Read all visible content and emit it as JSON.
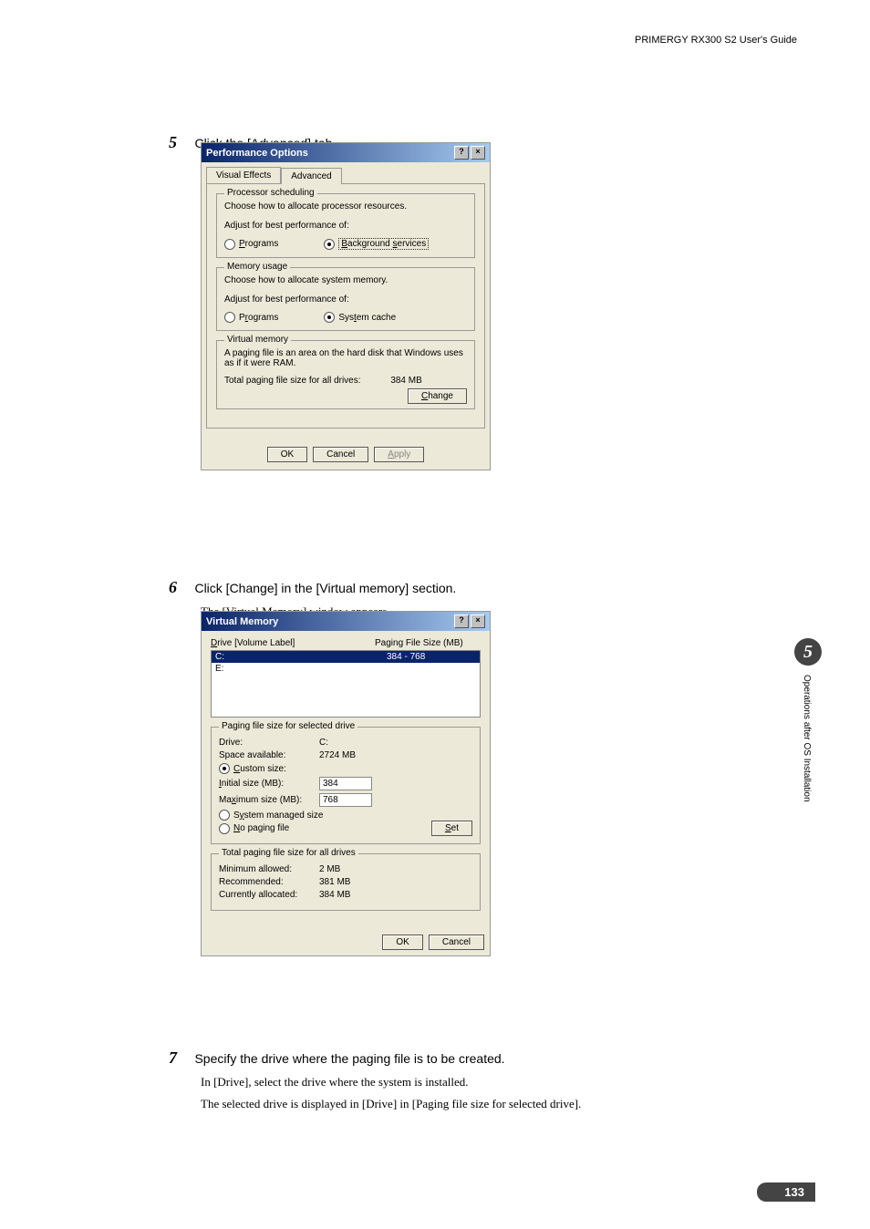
{
  "header": "PRIMERGY RX300 S2 User's Guide",
  "steps": {
    "s5": {
      "num": "5",
      "text": "Click the [Advanced] tab."
    },
    "s6": {
      "num": "6",
      "text": "Click [Change] in the [Virtual memory] section.",
      "sub": "The [Virtual Memory] window appears."
    },
    "s7": {
      "num": "7",
      "text": "Specify the drive where the paging file is to be created.",
      "sub1": "In [Drive], select the drive where the system is installed.",
      "sub2": "The selected drive is displayed in [Drive] in [Paging file size for selected drive]."
    }
  },
  "dialog1": {
    "title": "Performance Options",
    "tab1": "Visual Effects",
    "tab2": "Advanced",
    "group1": {
      "label": "Processor scheduling",
      "text1": "Choose how to allocate processor resources.",
      "text2": "Adjust for best performance of:",
      "opt1": "Programs",
      "opt2": "Background services"
    },
    "group2": {
      "label": "Memory usage",
      "text1": "Choose how to allocate system memory.",
      "text2": "Adjust for best performance of:",
      "opt1": "Programs",
      "opt2": "System cache"
    },
    "group3": {
      "label": "Virtual memory",
      "text1": "A paging file is an area on the hard disk that Windows uses as if it were RAM.",
      "text2": "Total paging file size for all drives:",
      "value": "384 MB",
      "change": "Change"
    },
    "ok": "OK",
    "cancel": "Cancel",
    "apply": "Apply"
  },
  "dialog2": {
    "title": "Virtual Memory",
    "col1": "Drive  [Volume Label]",
    "col2": "Paging File Size (MB)",
    "driveC": "C:",
    "driveE": "E:",
    "sizeC": "384 - 768",
    "group1": {
      "label": "Paging file size for selected drive",
      "drive_l": "Drive:",
      "drive_v": "C:",
      "space_l": "Space available:",
      "space_v": "2724 MB",
      "custom": "Custom size:",
      "init_l": "Initial size (MB):",
      "init_v": "384",
      "max_l": "Maximum size (MB):",
      "max_v": "768",
      "sys": "System managed size",
      "nop": "No paging file",
      "set": "Set"
    },
    "group2": {
      "label": "Total paging file size for all drives",
      "min_l": "Minimum allowed:",
      "min_v": "2 MB",
      "rec_l": "Recommended:",
      "rec_v": "381 MB",
      "cur_l": "Currently allocated:",
      "cur_v": "384 MB"
    },
    "ok": "OK",
    "cancel": "Cancel"
  },
  "side": {
    "num": "5",
    "text": "Operations after OS Installation"
  },
  "page": "133"
}
